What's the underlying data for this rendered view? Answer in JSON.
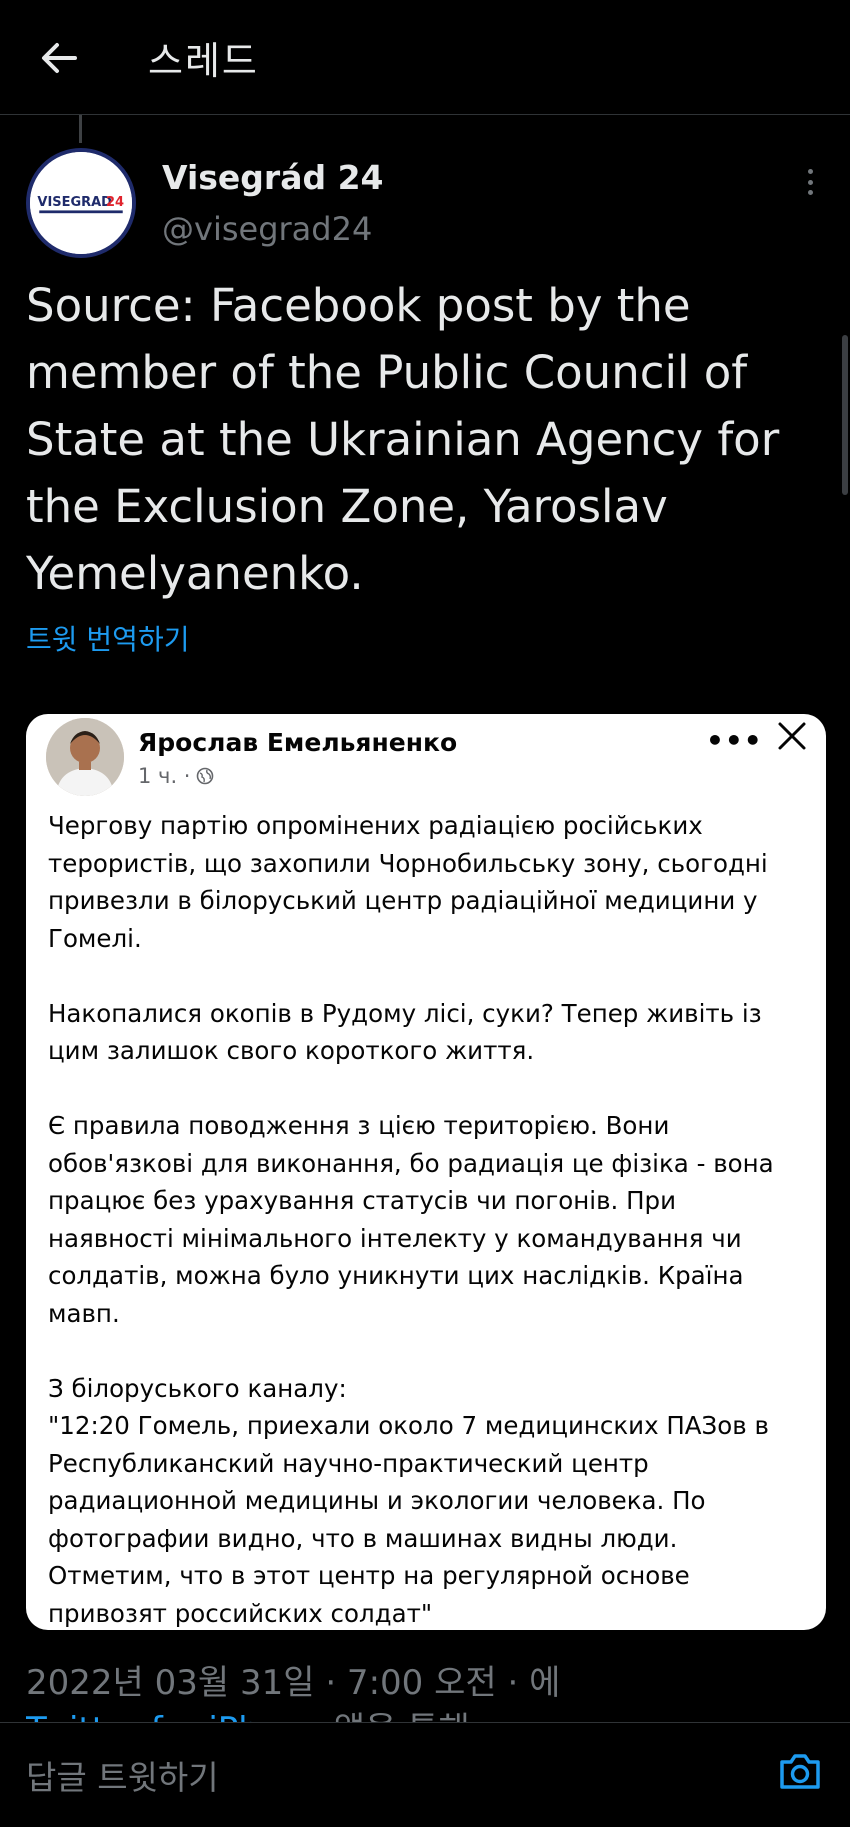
{
  "header": {
    "title": "스레드",
    "back_icon": "arrow-left-icon"
  },
  "tweet": {
    "author": {
      "display_name": "Visegrád 24",
      "handle": "@visegrad24",
      "avatar_text": "VISEGRAD24"
    },
    "text": "Source: Facebook post by the member of the Public Council of State at the Ukrainian Agency for the Exclusion Zone, Yaroslav Yemelyanenko.",
    "translate_label": "트윗 번역하기",
    "timestamp": "2022년 03월 31일 · 7:00 오전 · 에",
    "source": {
      "app": "Twitter for iPhone",
      "suffix": "앱을 통해"
    }
  },
  "media": {
    "author_name": "Ярослав Емельяненко",
    "time": "1 ч. ·",
    "more_label": "•••",
    "paragraphs": [
      "Чергову партію опромінених радіацією російських терористів, що захопили Чорнобильську зону, сьогодні привезли в білоруський центр радіаційної медицини у Гомелі.",
      "Накопалися окопів в Рудому лісі, суки? Тепер живіть із цим залишок свого короткого життя.",
      "Є правила поводження з цією територією. Вони обов'язкові для виконання, бо радиація це фізіка - вона працює без урахування статусів чи погонів. При наявності мінімального інтелекту у командування чи солдатів, можна було уникнути цих наслідків. Країна мавп.",
      "З білоруського каналу:\n\"12:20 Гомель, приехали около 7 медицинских ПАЗов в Республиканский научно-практический центр радиационной медицины и экологии человека. По фотографии видно, что в машинах видны люди. Отметим, что в этот центр на регулярной основе привозят российских солдат\""
    ]
  },
  "reply_bar": {
    "placeholder": "답글 트윗하기",
    "camera_icon": "camera-icon"
  },
  "colors": {
    "accent": "#1d9bf0",
    "background": "#000000",
    "secondary_text": "#71767b"
  }
}
